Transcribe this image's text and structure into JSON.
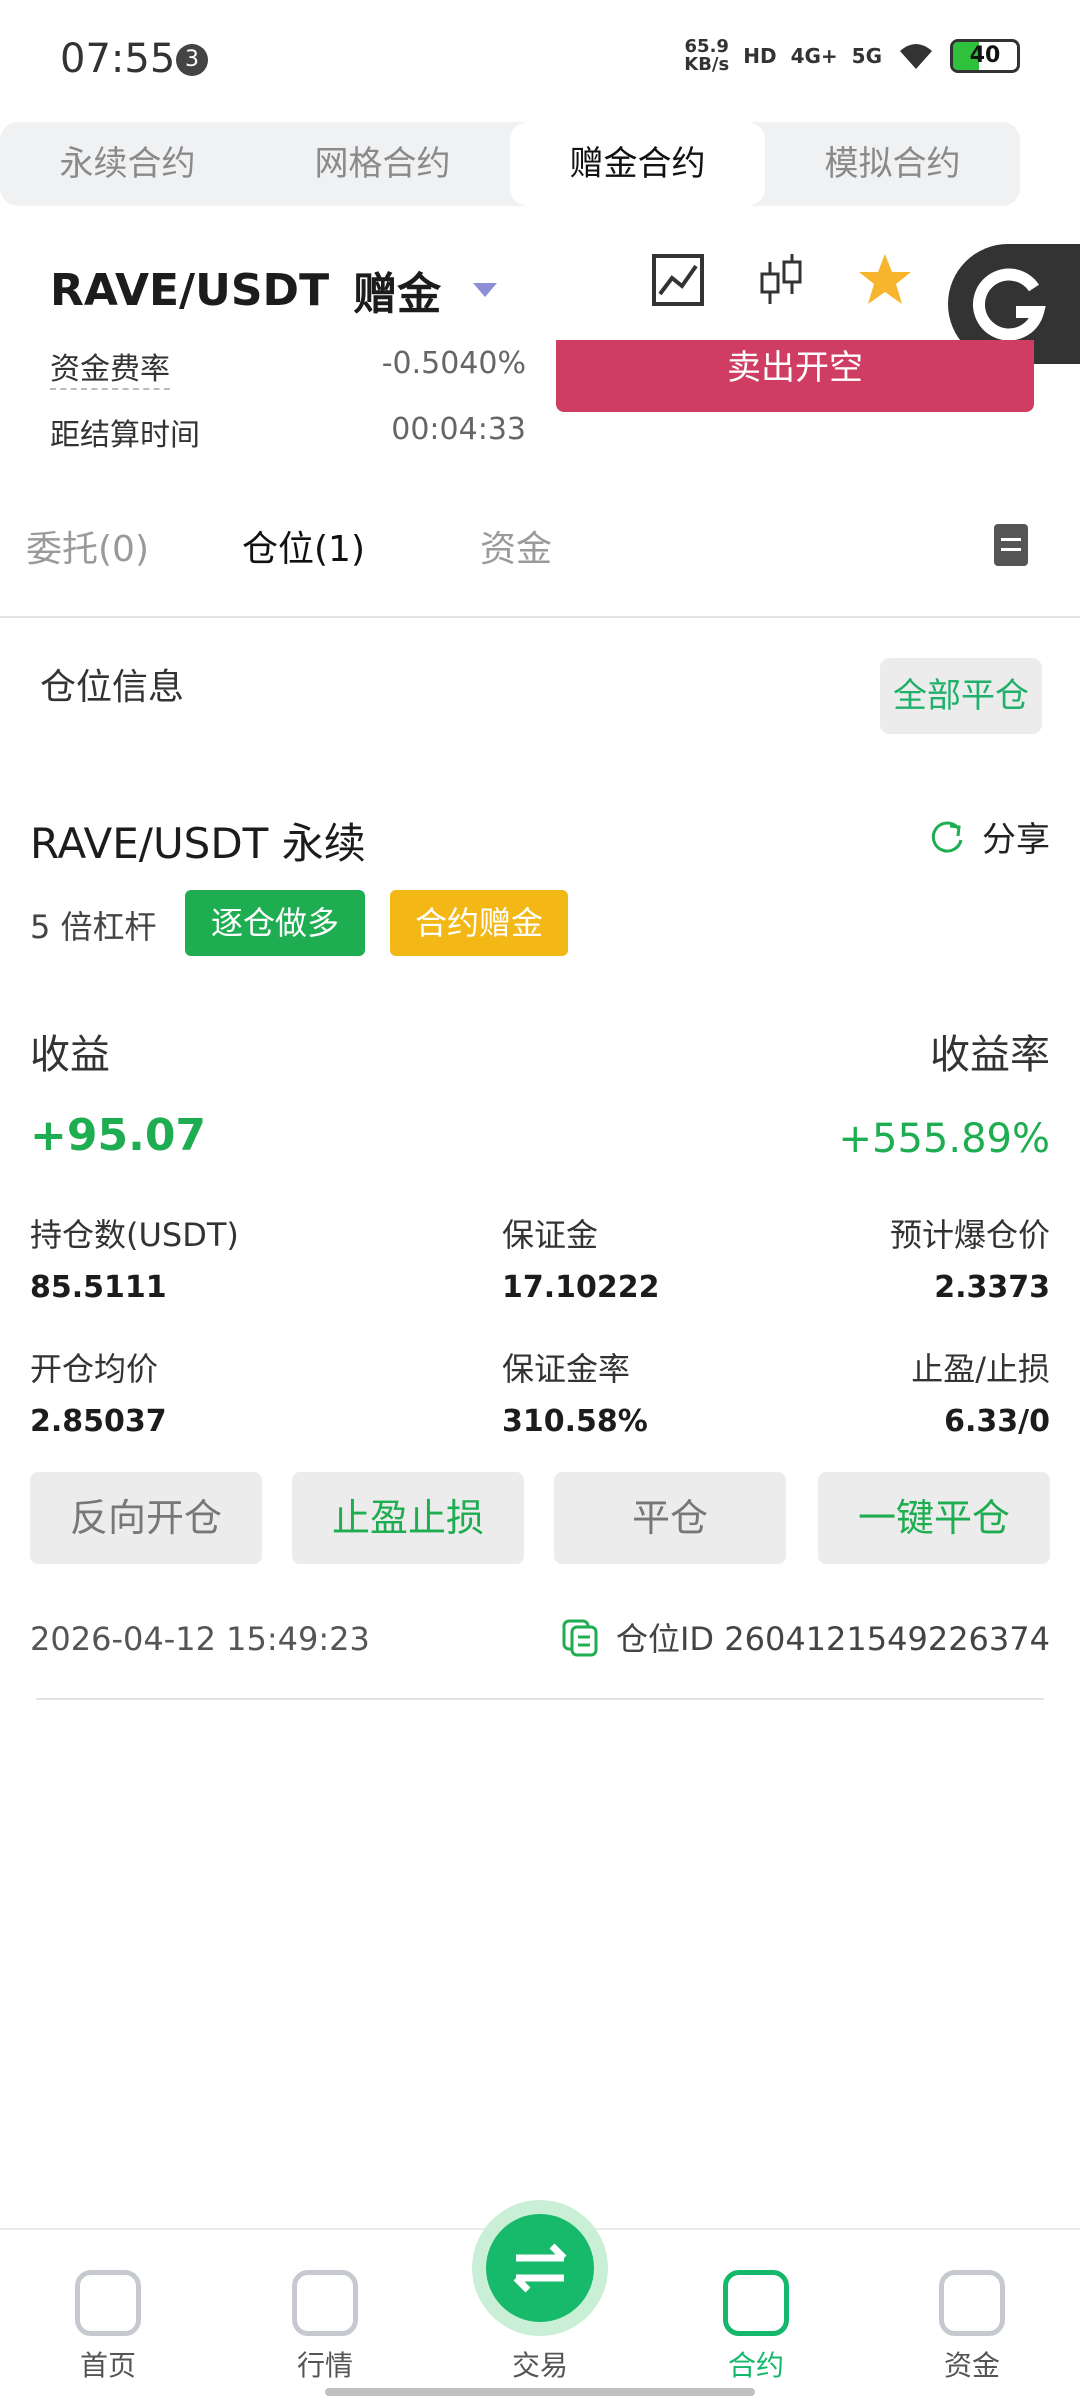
{
  "status_bar": {
    "time": "07:55",
    "notification_count": "3",
    "net_speed_value": "65.9",
    "net_speed_unit": "KB/s",
    "hd": "HD",
    "sim1": "4G+",
    "sim2": "5G",
    "battery": "40"
  },
  "top_tabs": [
    "永续合约",
    "网格合约",
    "赠金合约",
    "模拟合约"
  ],
  "active_top_tab": "赠金合约",
  "header": {
    "pair": "RAVE/USDT",
    "mode": "赠金",
    "icons": [
      "chart-line-icon",
      "candlestick-icon",
      "star-icon",
      "more-icon"
    ]
  },
  "funding": {
    "rate_label": "资金费率",
    "rate_value": "-0.5040%",
    "settle_label": "距结算时间",
    "settle_value": "00:04:33",
    "sell_button": "卖出开空"
  },
  "sub_tabs": {
    "orders": "委托(0)",
    "positions": "仓位(1)",
    "funds": "资金"
  },
  "position_section": {
    "title": "仓位信息",
    "close_all": "全部平仓"
  },
  "position": {
    "name": "RAVE/USDT 永续",
    "share": "分享",
    "leverage": "5 倍杠杆",
    "tag_direction": "逐仓做多",
    "tag_bonus": "合约赠金",
    "pnl_label": "收益",
    "pnl_rate_label": "收益率",
    "pnl_value": "+95.07",
    "pnl_rate_value": "+555.89%",
    "holdings_label": "持仓数(USDT)",
    "holdings_value": "85.5111",
    "margin_label": "保证金",
    "margin_value": "17.10222",
    "liq_label": "预计爆仓价",
    "liq_value": "2.3373",
    "entry_label": "开仓均价",
    "entry_value": "2.85037",
    "margin_rate_label": "保证金率",
    "margin_rate_value": "310.58%",
    "tpsl_label": "止盈/止损",
    "tpsl_value": "6.33/0",
    "actions": [
      "反向开仓",
      "止盈止损",
      "平仓",
      "一键平仓"
    ],
    "timestamp": "2026-04-12 15:49:23",
    "id_text": "仓位ID 2604121549226374"
  },
  "bottom_nav": [
    "首页",
    "行情",
    "交易",
    "合约",
    "资金"
  ],
  "active_nav": "合约",
  "colors": {
    "green": "#1fad51",
    "red": "#cf3d63",
    "yellow": "#f3b716",
    "nav_active": "#15b86a"
  }
}
